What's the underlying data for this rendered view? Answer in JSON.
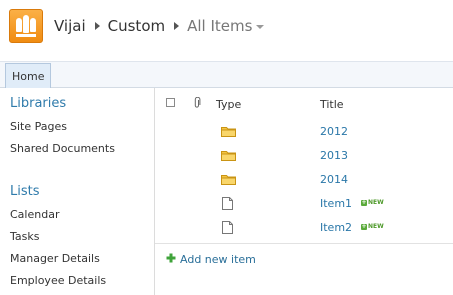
{
  "breadcrumb": {
    "site": "Vijai",
    "list": "Custom",
    "view": "All Items"
  },
  "ribbon": {
    "tabs": [
      "Home"
    ]
  },
  "nav": {
    "libraries_heading": "Libraries",
    "libraries": [
      "Site Pages",
      "Shared Documents"
    ],
    "lists_heading": "Lists",
    "lists": [
      "Calendar",
      "Tasks",
      "Manager Details",
      "Employee Details"
    ]
  },
  "list": {
    "columns": {
      "type": "Type",
      "title": "Title"
    },
    "rows": [
      {
        "type": "folder",
        "title": "2012",
        "new": false
      },
      {
        "type": "folder",
        "title": "2013",
        "new": false
      },
      {
        "type": "folder",
        "title": "2014",
        "new": false
      },
      {
        "type": "document",
        "title": "Item1",
        "new": true
      },
      {
        "type": "document",
        "title": "Item2",
        "new": true
      }
    ],
    "new_badge": "NEW",
    "add_new_item": "Add new item"
  },
  "colors": {
    "link": "#2a77a8",
    "heading": "#2f7bab",
    "logo": "#f39c1b",
    "new_badge": "#4f9a2b"
  }
}
